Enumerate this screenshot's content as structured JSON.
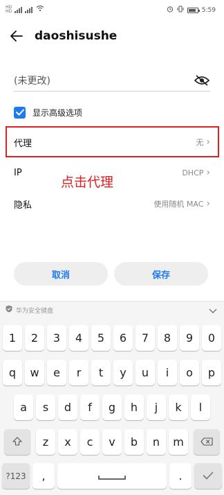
{
  "status_bar": {
    "sim1": "HD",
    "sim2": "HD",
    "sig1": "4G",
    "sig2": "4G",
    "battery_level": 0.8,
    "time": "5:59"
  },
  "header": {
    "title": "daoshisushe",
    "back_icon": "arrow-left-icon"
  },
  "password": {
    "value": "(未更改)",
    "visibility_icon": "eye-off-icon"
  },
  "advanced": {
    "checked": true,
    "label": "显示高级选项"
  },
  "settings": [
    {
      "label": "代理",
      "value": "无"
    },
    {
      "label": "IP",
      "value": "DHCP"
    },
    {
      "label": "隐私",
      "value": "使用随机 MAC"
    }
  ],
  "annotation": "点击代理",
  "buttons": {
    "cancel": "取消",
    "save": "保存"
  },
  "keyboard": {
    "brand": "华为安全键盘",
    "row_numbers": [
      "1",
      "2",
      "3",
      "4",
      "5",
      "6",
      "7",
      "8",
      "9",
      "0"
    ],
    "row_q": [
      "q",
      "w",
      "e",
      "r",
      "t",
      "y",
      "u",
      "i",
      "o",
      "p"
    ],
    "row_a": [
      "a",
      "s",
      "d",
      "f",
      "g",
      "h",
      "j",
      "k",
      "l"
    ],
    "row_z": [
      "z",
      "x",
      "c",
      "v",
      "b",
      "n",
      "m"
    ],
    "symbols_key": "?123",
    "comma": ",",
    "period": "."
  },
  "colors": {
    "accent": "#1d7bef",
    "highlight": "#e02020"
  }
}
